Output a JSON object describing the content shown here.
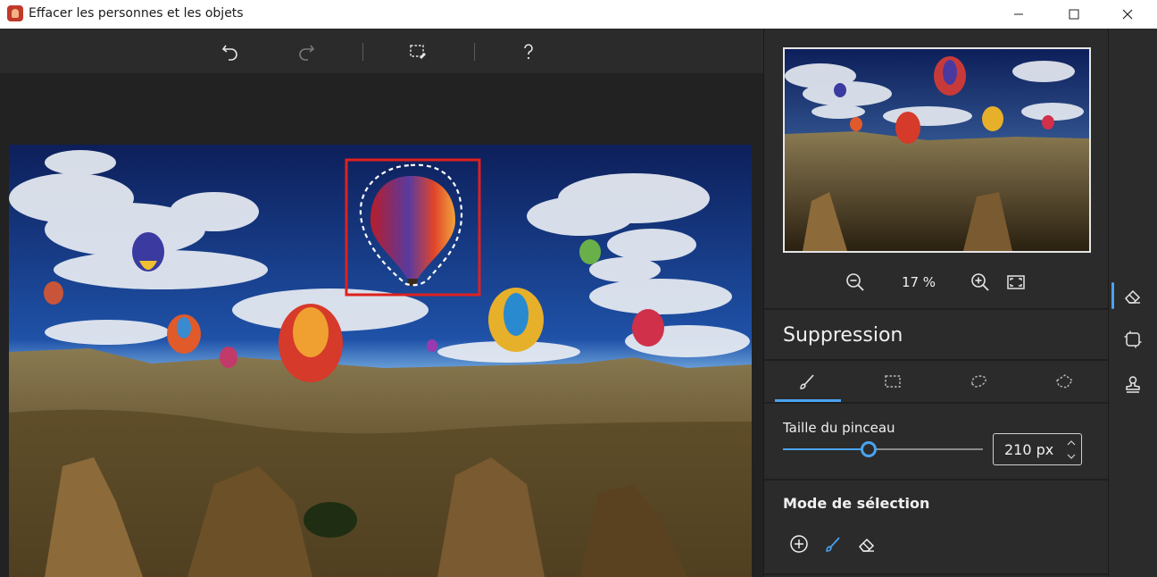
{
  "window": {
    "title": "Effacer les personnes et les objets"
  },
  "colors": {
    "accent": "#4aa3f0",
    "selection_box": "#e0201e"
  },
  "toolbar": {
    "icons": [
      "undo-icon",
      "redo-icon",
      "selection-edit-icon",
      "help-icon"
    ]
  },
  "navigator": {
    "zoom": "17 %"
  },
  "panel": {
    "section_title": "Suppression",
    "tabs": [
      "brush-tool-icon",
      "rect-select-icon",
      "lasso-icon",
      "polygon-lasso-icon"
    ],
    "brush_size_label": "Taille du pinceau",
    "brush_size_value": "210 px",
    "brush_size_fraction": 0.43,
    "mode_title": "Mode de sélection",
    "modes": [
      "add-icon",
      "brush-icon",
      "eraser-icon"
    ]
  },
  "rail": {
    "icons": [
      "eraser-tool-icon",
      "crop-tool-icon",
      "stamp-tool-icon"
    ]
  }
}
